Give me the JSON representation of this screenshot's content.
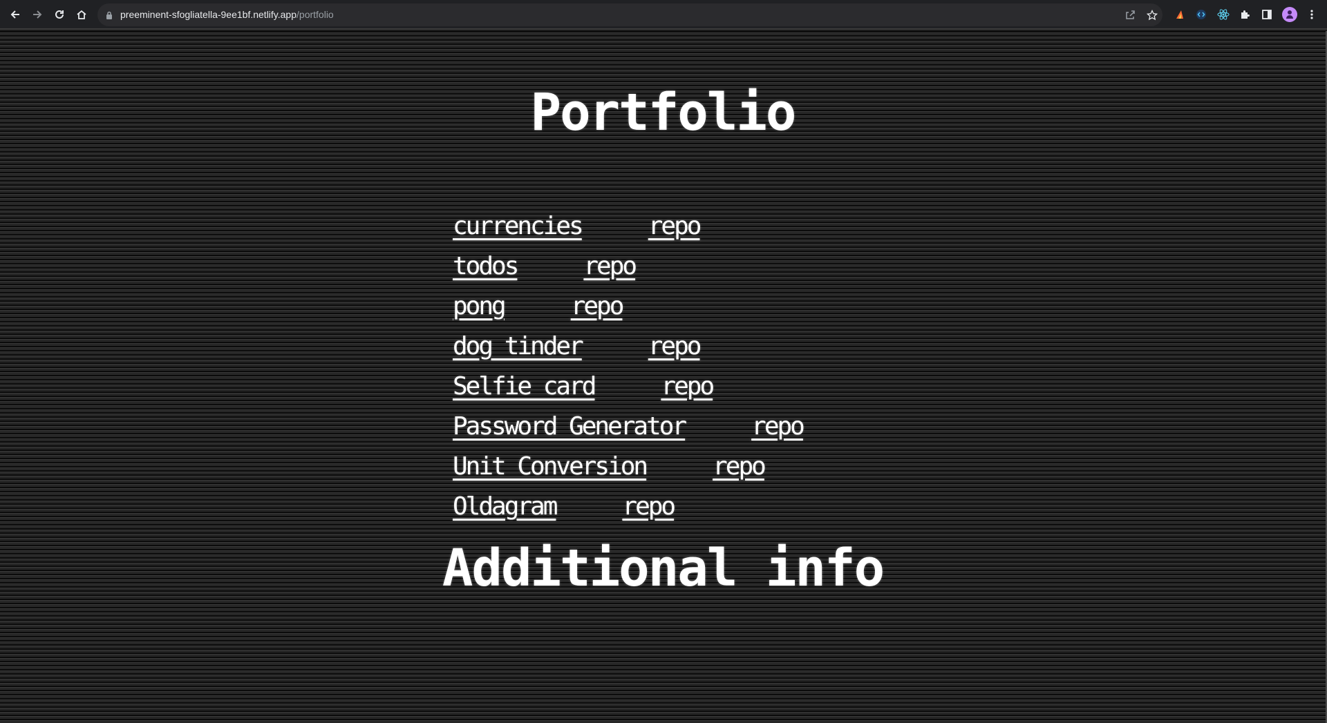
{
  "browser": {
    "url_host": "preeminent-sfogliatella-9ee1bf.netlify.app",
    "url_path": "/portfolio",
    "icons": {
      "back": "back-arrow-icon",
      "forward": "forward-arrow-icon",
      "reload": "reload-icon",
      "home": "home-icon",
      "lock": "lock-icon",
      "share": "share-icon",
      "bookmark": "star-icon",
      "extensions": "puzzle-icon",
      "side_panel": "side-panel-icon",
      "menu": "kebab-menu-icon"
    }
  },
  "page": {
    "title": "Portfolio",
    "projects": [
      {
        "name": "currencies",
        "repo": "repo"
      },
      {
        "name": "todos",
        "repo": "repo"
      },
      {
        "name": "pong",
        "repo": "repo"
      },
      {
        "name": "dog tinder",
        "repo": "repo"
      },
      {
        "name": "Selfie card",
        "repo": "repo"
      },
      {
        "name": "Password Generator",
        "repo": "repo"
      },
      {
        "name": "Unit Conversion",
        "repo": "repo"
      },
      {
        "name": "Oldagram",
        "repo": "repo"
      }
    ],
    "subtitle": "Additional info"
  },
  "colors": {
    "background": "#1c1c1c",
    "text": "#ffffff",
    "chrome": "#202124",
    "avatar": "#c58af9"
  }
}
